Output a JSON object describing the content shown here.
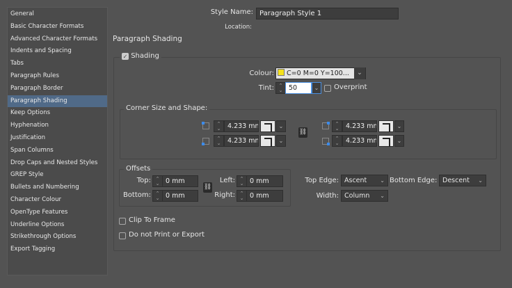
{
  "sidebar": {
    "items": [
      "General",
      "Basic Character Formats",
      "Advanced Character Formats",
      "Indents and Spacing",
      "Tabs",
      "Paragraph Rules",
      "Paragraph Border",
      "Paragraph Shading",
      "Keep Options",
      "Hyphenation",
      "Justification",
      "Span Columns",
      "Drop Caps and Nested Styles",
      "GREP Style",
      "Bullets and Numbering",
      "Character Colour",
      "OpenType Features",
      "Underline Options",
      "Strikethrough Options",
      "Export Tagging"
    ],
    "selected": "Paragraph Shading"
  },
  "header": {
    "style_name_label": "Style Name:",
    "style_name_value": "Paragraph Style 1",
    "location_label": "Location:"
  },
  "section_title": "Paragraph Shading",
  "shading": {
    "label": "Shading",
    "checked": true,
    "colour_label": "Colour:",
    "colour_value": "C=0 M=0 Y=100...",
    "swatch_color": "#f5e11c",
    "tint_label": "Tint:",
    "tint_value": "50",
    "overprint_label": "Overprint",
    "overprint_checked": false
  },
  "corner": {
    "title": "Corner Size and Shape:",
    "top_left": "4.233 mn",
    "top_right": "4.233 mn",
    "bottom_left": "4.233 mn",
    "bottom_right": "4.233 mn"
  },
  "offsets": {
    "title": "Offsets",
    "top_label": "Top:",
    "top": "0 mm",
    "bottom_label": "Bottom:",
    "bottom": "0 mm",
    "left_label": "Left:",
    "left": "0 mm",
    "right_label": "Right:",
    "right": "0 mm"
  },
  "edges": {
    "top_edge_label": "Top Edge:",
    "top_edge": "Ascent",
    "bottom_edge_label": "Bottom Edge:",
    "bottom_edge": "Descent",
    "width_label": "Width:",
    "width": "Column"
  },
  "options": {
    "clip_label": "Clip To Frame",
    "clip_checked": false,
    "noprint_label": "Do not Print or Export",
    "noprint_checked": false
  },
  "colors": {
    "selection": "#506a88",
    "background": "#535353"
  }
}
